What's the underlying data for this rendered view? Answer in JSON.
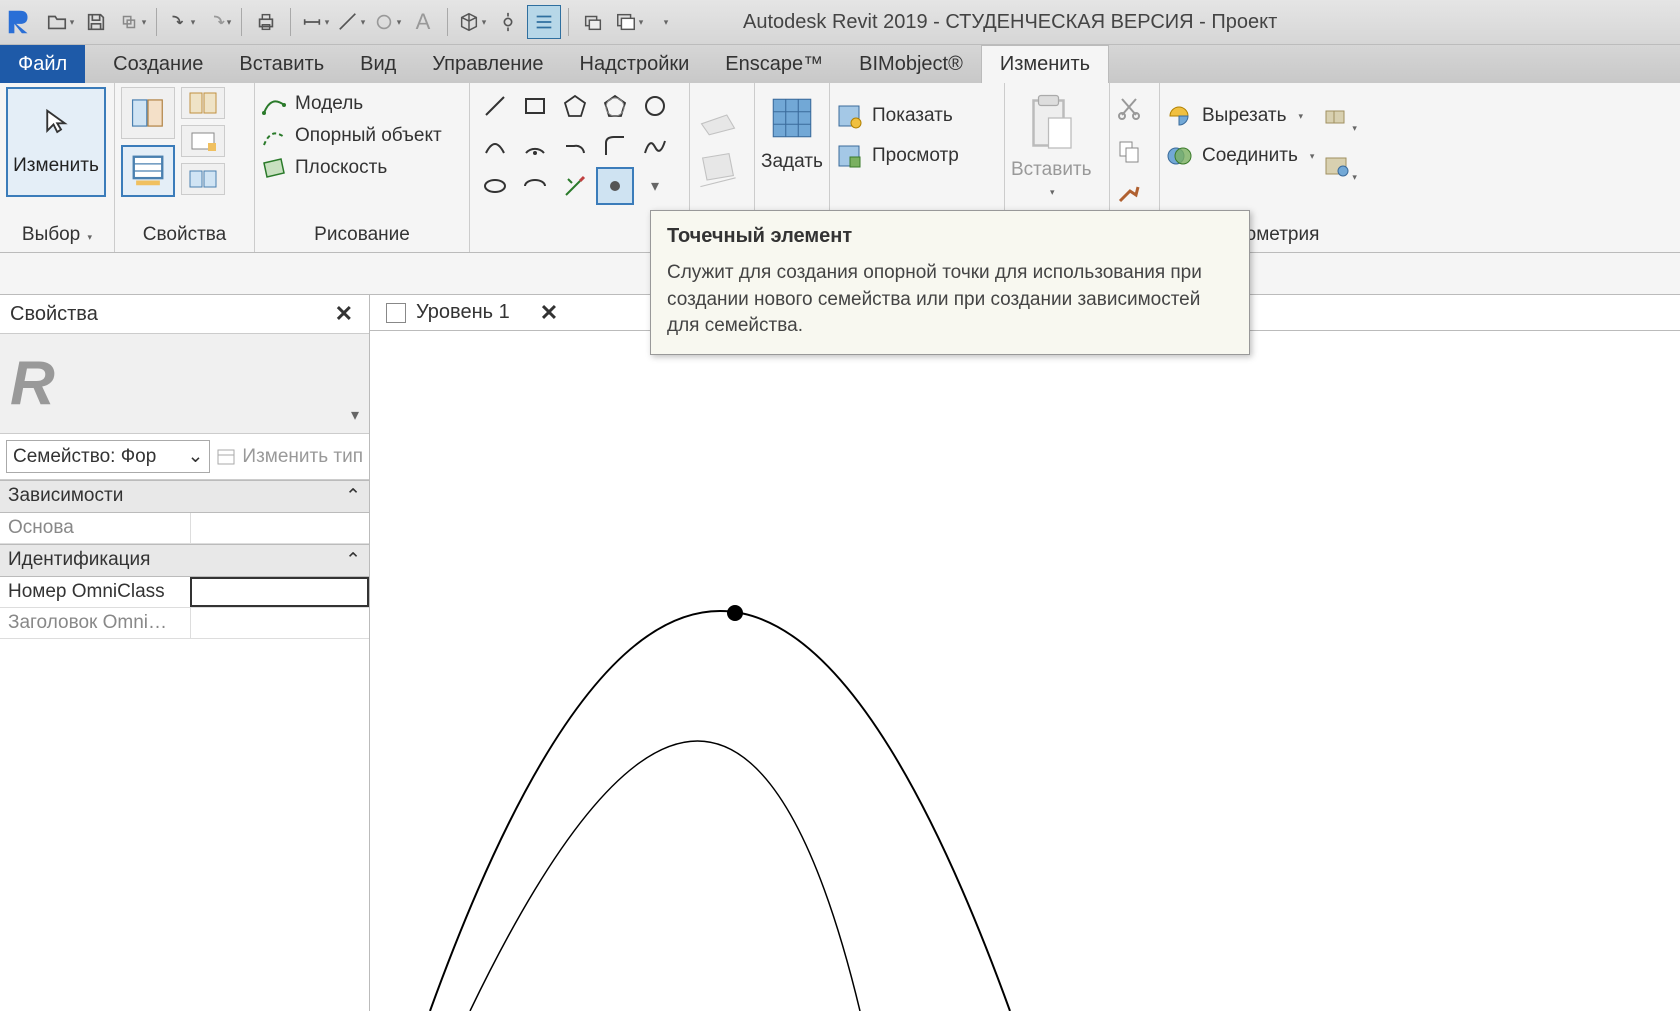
{
  "title": "Autodesk Revit 2019 - СТУДЕНЧЕСКАЯ ВЕРСИЯ - Проект",
  "tabs": {
    "file": "Файл",
    "items": [
      "Создание",
      "Вставить",
      "Вид",
      "Управление",
      "Надстройки",
      "Enscape™",
      "BIMobject®",
      "Изменить"
    ]
  },
  "ribbon": {
    "select": {
      "button": "Изменить",
      "panel": "Выбор"
    },
    "props_panel": "Свойства",
    "model": {
      "row1": "Модель",
      "row2": "Опорный объект",
      "row3": "Плоскость"
    },
    "draw_panel": "Рисование",
    "set": {
      "label": "Задать"
    },
    "show": {
      "show": "Показать",
      "view": "Просмотр"
    },
    "paste": "Вставить",
    "geometry": {
      "cut": "Вырезать",
      "join": "Соединить",
      "panel": "ометрия"
    }
  },
  "tooltip": {
    "title": "Точечный элемент",
    "body": "Служит для создания опорной точки для использования при создании нового семейства или при создании зависимостей для семейства."
  },
  "properties": {
    "title": "Свойства",
    "type_selector": "Семейство: Фор",
    "edit_type": "Изменить тип",
    "section1": "Зависимости",
    "row1_label": "Основа",
    "section2": "Идентификация",
    "row2_label": "Номер OmniClass",
    "row2_value": "",
    "row3_label": "Заголовок Omni…"
  },
  "view": {
    "tab": "Уровень 1"
  }
}
